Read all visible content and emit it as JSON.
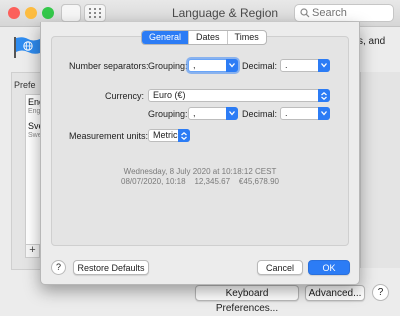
{
  "window": {
    "title": "Language & Region",
    "search_placeholder": "Search",
    "description_fragment": "s, and",
    "preferred_label_fragment": "Prefe",
    "language_list": [
      {
        "name": "Eng",
        "sub": "Eng"
      },
      {
        "name": "Sve",
        "sub": "Swe"
      }
    ],
    "add_label": "+",
    "keyboard_preferences_label": "Keyboard Preferences...",
    "advanced_label": "Advanced...",
    "help_label": "?"
  },
  "sheet": {
    "tabs": [
      {
        "label": "General",
        "active": true
      },
      {
        "label": "Dates",
        "active": false
      },
      {
        "label": "Times",
        "active": false
      }
    ],
    "number_separators_label": "Number separators:",
    "grouping_label": "Grouping:",
    "grouping_value": ",",
    "decimal_label": "Decimal:",
    "decimal_value": ".",
    "currency_label": "Currency:",
    "currency_value": "Euro (€)",
    "currency_grouping_label": "Grouping:",
    "currency_grouping_value": ",",
    "currency_decimal_label": "Decimal:",
    "currency_decimal_value": ".",
    "measurement_units_label": "Measurement units:",
    "measurement_units_value": "Metric",
    "preview_line1": "Wednesday, 8 July 2020 at 10:18:12 CEST",
    "preview_line2_date": "08/07/2020, 10:18",
    "preview_line2_number": "12,345.67",
    "preview_line2_currency": "€45,678.90",
    "help_label": "?",
    "restore_defaults_label": "Restore Defaults",
    "cancel_label": "Cancel",
    "ok_label": "OK"
  },
  "colors": {
    "accent": "#2c7cf5",
    "close": "#fc605b",
    "minimize": "#fdbc40",
    "zoom": "#34c84a"
  }
}
